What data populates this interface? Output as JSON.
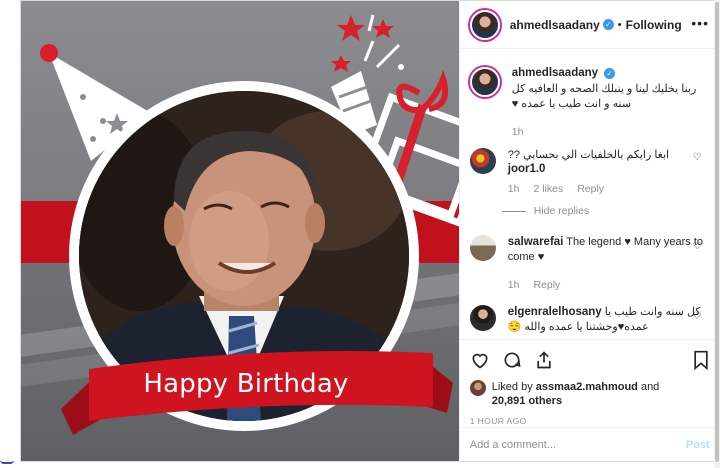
{
  "post": {
    "username": "ahmedlsaadany",
    "follow_state": "Following",
    "more_label": "•••",
    "verified_mark": "✓",
    "image_banner_text": "Happy Birthday",
    "brand_color": "#c0111d",
    "accent_blue": "#3897f0"
  },
  "comments": [
    {
      "username": "ahmedlsaadany",
      "verified": true,
      "text": "ربنا يخليك لينا و ينبلك الصحه و العافيه كل سنه و انت طيب يا عمده ♥",
      "time": "1h"
    },
    {
      "username": "joor1.0",
      "text": "ابغا رايكم بالخلفيات الي بحسابي ??",
      "time": "1h",
      "likes": "2 likes",
      "reply": "Reply",
      "hide_replies": "Hide replies"
    },
    {
      "username": "salwarefai",
      "text": "The legend ♥ Many years to come ♥",
      "time": "1h",
      "reply": "Reply"
    },
    {
      "username": "elgenralelhosany",
      "text": "كل سنه وانت طيب يا عمده♥وحشتنا يا عمده والله 😌"
    }
  ],
  "likes": {
    "prefix": "Liked by ",
    "user": "assmaa2.mahmoud",
    "connector": " and",
    "count": "20,891 others"
  },
  "time_ago": "1 HOUR AGO",
  "add_comment": {
    "placeholder": "Add a comment...",
    "post_label": "Post"
  },
  "icons": [
    "heart-icon",
    "comment-icon",
    "share-icon",
    "bookmark-icon"
  ]
}
